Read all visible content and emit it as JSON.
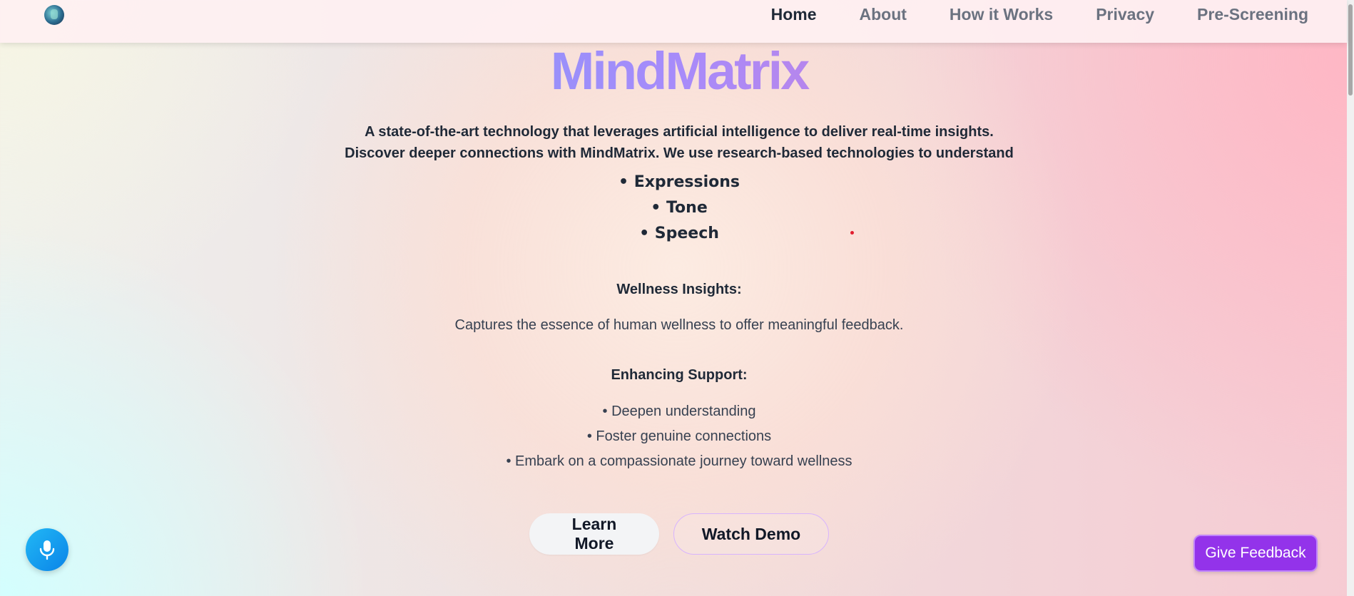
{
  "header": {
    "logo_icon": "brain-logo-icon",
    "nav": [
      {
        "label": "Home",
        "active": true
      },
      {
        "label": "About",
        "active": false
      },
      {
        "label": "How it Works",
        "active": false
      },
      {
        "label": "Privacy",
        "active": false
      },
      {
        "label": "Pre-Screening",
        "active": false
      }
    ]
  },
  "hero": {
    "title": "MindMatrix",
    "tagline_1": "A state-of-the-art technology that leverages artificial intelligence to deliver real-time insights.",
    "tagline_2": "Discover deeper connections with MindMatrix. We use research-based technologies to understand",
    "features": [
      "• Expressions",
      "• Tone",
      "• Speech"
    ]
  },
  "wellness": {
    "title": "Wellness Insights:",
    "text": "Captures the essence of human wellness to offer meaningful feedback."
  },
  "support": {
    "title": "Enhancing Support:",
    "items": [
      "• Deepen understanding",
      "• Foster genuine connections",
      "• Embark on a compassionate journey toward wellness"
    ]
  },
  "actions": {
    "learn_more": "Learn More",
    "watch_demo": "Watch Demo"
  },
  "floating": {
    "mic_icon": "microphone-icon",
    "feedback_label": "Give Feedback"
  },
  "colors": {
    "brand_gradient": [
      "#60a5fa",
      "#a78bfa",
      "#f472b6"
    ],
    "feedback_button": "#9333ea",
    "mic_button": "#0a84e8"
  }
}
